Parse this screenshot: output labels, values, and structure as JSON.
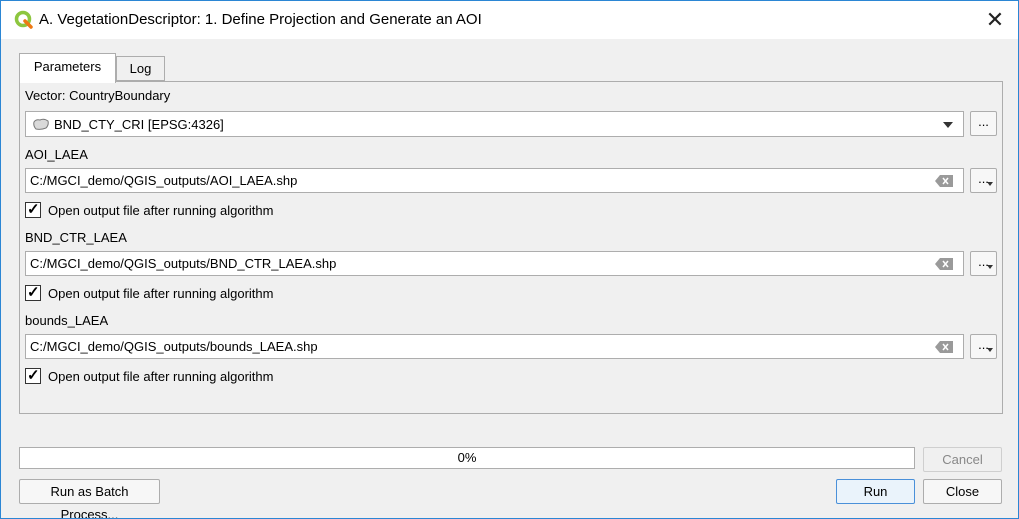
{
  "window": {
    "title": "A. VegetationDescriptor: 1. Define Projection and Generate an AOI",
    "close_glyph": "✕",
    "app_icon": "qgis-logo"
  },
  "tabs": [
    {
      "label": "Parameters",
      "active": true
    },
    {
      "label": "Log",
      "active": false
    }
  ],
  "params": {
    "vector_label": "Vector: CountryBoundary",
    "vector_value": "BND_CTY_CRI [EPSG:4326]",
    "outputs": [
      {
        "label": "AOI_LAEA",
        "path": "C:/MGCI_demo/QGIS_outputs/AOI_LAEA.shp",
        "open_after": true
      },
      {
        "label": "BND_CTR_LAEA",
        "path": "C:/MGCI_demo/QGIS_outputs/BND_CTR_LAEA.shp",
        "open_after": true
      },
      {
        "label": "bounds_LAEA",
        "path": "C:/MGCI_demo/QGIS_outputs/bounds_LAEA.shp",
        "open_after": true
      }
    ],
    "open_after_label": "Open output file after running algorithm",
    "browse_label": "..."
  },
  "footer": {
    "progress_text": "0%",
    "progress_value": 0,
    "cancel_label": "Cancel",
    "batch_label": "Run as Batch Process...",
    "run_label": "Run",
    "close_label": "Close"
  },
  "colors": {
    "accent": "#4a90d9",
    "qgis_green": "#8dc63f"
  }
}
